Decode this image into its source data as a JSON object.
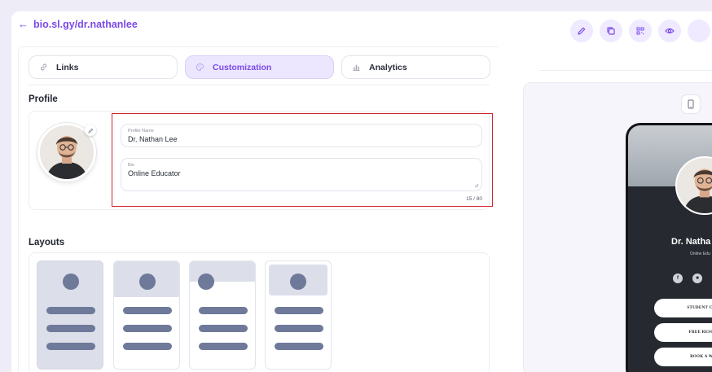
{
  "header": {
    "back_link": "bio.sl.gy/dr.nathanlee"
  },
  "toolbar": {
    "icons": [
      "edit-icon",
      "copy-icon",
      "qr-code-icon",
      "eye-icon"
    ]
  },
  "tabs": [
    {
      "label": "Links",
      "icon": "link-icon",
      "active": false
    },
    {
      "label": "Customization",
      "icon": "palette-icon",
      "active": true
    },
    {
      "label": "Analytics",
      "icon": "bar-chart-icon",
      "active": false
    }
  ],
  "profile": {
    "section_title": "Profile",
    "name_label": "Profile Name",
    "name_value": "Dr. Nathan Lee",
    "bio_label": "Bio",
    "bio_value": "Online Educator",
    "counter": "15 / 80"
  },
  "layouts": {
    "section_title": "Layouts",
    "options": [
      "layout-full-background",
      "layout-header-band-center",
      "layout-header-band-left",
      "layout-card-header"
    ]
  },
  "preview": {
    "name": "Dr. Natha",
    "subtitle": "Online Edu",
    "social_icons": [
      "facebook-icon",
      "instagram-icon",
      "link-icon"
    ],
    "buttons": [
      "STUDENT CON",
      "FREE RESOU",
      "BOOK A WE"
    ]
  },
  "colors": {
    "accent": "#7b49e8",
    "accent_soft": "#ece6ff",
    "highlight": "#d0262f",
    "layout_shape": "#6f7a9a"
  }
}
